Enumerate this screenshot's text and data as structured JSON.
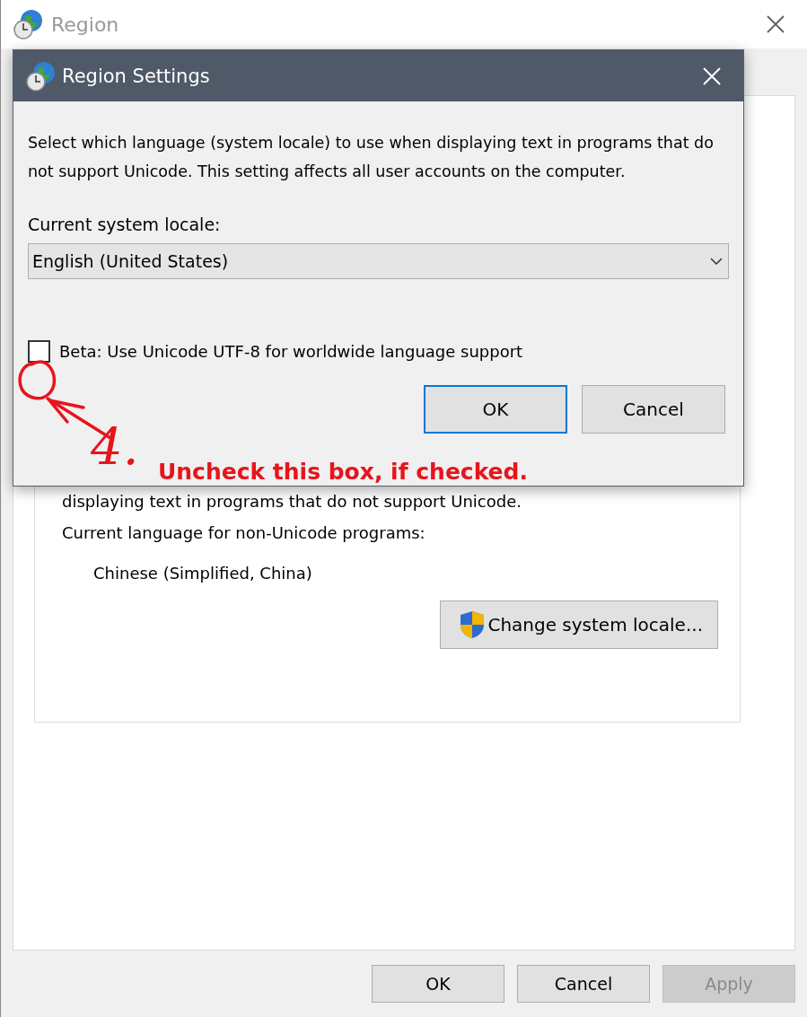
{
  "window": {
    "title": "Region"
  },
  "panel": {
    "partial_text": "displaying text in programs that do not support Unicode.",
    "current_label": "Current language for non-Unicode programs:",
    "current_value": "Chinese (Simplified, China)",
    "change_button": "Change system locale..."
  },
  "buttons": [
    {
      "label": "OK",
      "disabled": false
    },
    {
      "label": "Cancel",
      "disabled": false
    },
    {
      "label": "Apply",
      "disabled": true
    }
  ],
  "dialog": {
    "title": "Region Settings",
    "description": "Select which language (system locale) to use when displaying text in programs that do not support Unicode. This setting affects all user accounts on the computer.",
    "locale_label": "Current system locale:",
    "locale_value": "English (United States)",
    "checkbox": {
      "label": "Beta: Use Unicode UTF-8 for worldwide language support",
      "checked": false
    },
    "buttons": [
      {
        "label": "OK",
        "default": true
      },
      {
        "label": "Cancel",
        "default": false
      }
    ]
  },
  "annotation": {
    "number": "4.",
    "text": "Uncheck this box, if checked."
  }
}
